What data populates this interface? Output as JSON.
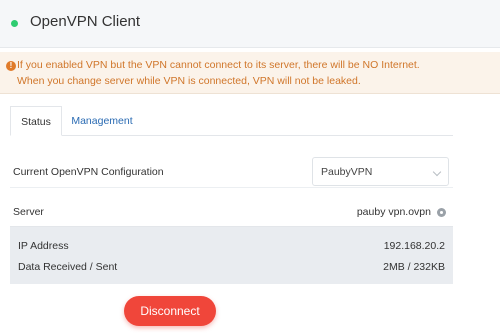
{
  "header": {
    "title": "OpenVPN Client",
    "status_color": "#2ecc71"
  },
  "warning": {
    "icon": "exclamation-circle-icon",
    "icon_color": "#e07b2a",
    "text_color": "#d0762a",
    "line1": "If you enabled VPN but the VPN cannot connect to its server, there will be NO Internet.",
    "line2": "When you change server while VPN is connected, VPN will not be leaked."
  },
  "tabs": [
    {
      "label": "Status",
      "active": true
    },
    {
      "label": "Management",
      "active": false
    }
  ],
  "config": {
    "label": "Current OpenVPN Configuration",
    "selected": "PaubyVPN"
  },
  "server": {
    "label": "Server",
    "value": "pauby vpn.ovpn",
    "icon": "gear-icon"
  },
  "info": {
    "ip_label": "IP Address",
    "ip_value": "192.168.20.2",
    "data_label": "Data Received / Sent",
    "data_value": "2MB / 232KB"
  },
  "actions": {
    "disconnect_label": "Disconnect",
    "disconnect_color": "#f0463a"
  }
}
